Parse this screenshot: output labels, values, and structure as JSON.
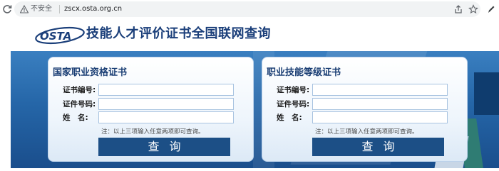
{
  "browser": {
    "security_label": "不安全",
    "url": "zscx.osta.org.cn"
  },
  "site": {
    "logo_text": "OSTA",
    "title": "技能人才评价证书全国联网查询"
  },
  "panels": [
    {
      "title": "国家职业资格证书",
      "fields": {
        "cert_no_label": "证书编号:",
        "id_no_label": "证件号码:",
        "name_label": "姓　名:"
      },
      "values": {
        "cert_no": "",
        "id_no": "",
        "name": ""
      },
      "note": "注：以上三项输入任意两项即可查询。",
      "button": "查询"
    },
    {
      "title": "职业技能等级证书",
      "fields": {
        "cert_no_label": "证书编号:",
        "id_no_label": "证件号码:",
        "name_label": "姓　名:"
      },
      "values": {
        "cert_no": "",
        "id_no": "",
        "name": ""
      },
      "note": "注：以上三项输入任意两项即可查询。",
      "button": "查询"
    }
  ],
  "colors": {
    "title_blue": "#1b3f7a",
    "button_blue": "#1c4f86",
    "banner_blue": "#2566a8"
  }
}
